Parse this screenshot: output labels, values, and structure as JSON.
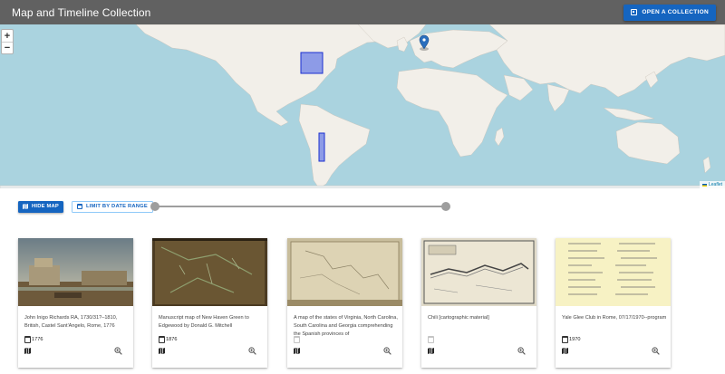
{
  "app": {
    "title": "Map and Timeline Collection",
    "open_button": "OPEN A COLLECTION",
    "accent": "#1565c0",
    "appbar_color": "#616161"
  },
  "map": {
    "zoom_in": "+",
    "zoom_out": "−",
    "attribution": "Leaflet",
    "water_color": "#aad3df",
    "land_color": "#f2efe9",
    "marker_icon": "map-pin-icon"
  },
  "controls": {
    "hide_map": "HIDE MAP",
    "limit_by_date": "LIMIT BY DATE RANGE"
  },
  "cards": [
    {
      "title": "John Inigo Richards RA, 1730/31?–1810, British, Castel Sant'Angelo, Rome, 1776",
      "date": "1776",
      "has_date": true
    },
    {
      "title": "Manuscript map of New Haven Green to Edgewood by Donald G. Mitchell",
      "date": "1876",
      "has_date": true
    },
    {
      "title": "A map of the states of Virginia, North Carolina, South Carolina and Georgia comprehending the Spanish provinces of",
      "date": "",
      "has_date": false
    },
    {
      "title": "Chili [cartographic material]",
      "date": "",
      "has_date": false
    },
    {
      "title": "Yale Glee Club in Rome, 07/17/1970--program",
      "date": "1970",
      "has_date": true
    }
  ]
}
